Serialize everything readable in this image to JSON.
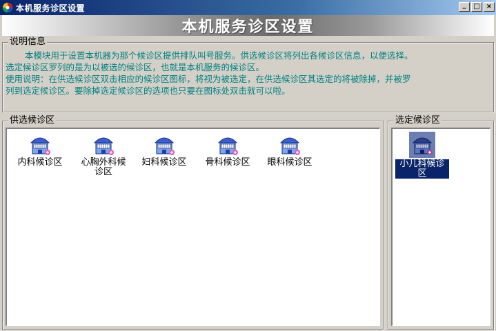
{
  "window": {
    "title": "本机服务诊区设置",
    "buttons": {
      "minimize": "_",
      "maximize": "□",
      "close": "×"
    }
  },
  "banner": {
    "title": "本机服务诊区设置"
  },
  "info": {
    "label": "说明信息",
    "line1": "本模块用于设置本机器为那个候诊区提供排队叫号服务。供选候诊区将列出各候诊区信息，以便选择。",
    "line2": "选定候诊区罗列的是为以被选的候诊区，也就是本机服务的候诊区。",
    "line3": "使用说明：在供选候诊区双击相应的候诊区图标，将视为被选定，在供选候诊区其选定的将被除掉，并被罗",
    "line4": "列到选定候诊区。要除掉选定候诊区的选项也只要在图标处双击就可以啦。"
  },
  "available": {
    "label": "供选候诊区",
    "items": [
      {
        "label": "内科候诊区"
      },
      {
        "label": "心胸外科候诊区"
      },
      {
        "label": "妇科候诊区"
      },
      {
        "label": "骨科候诊区"
      },
      {
        "label": "眼科候诊区"
      }
    ]
  },
  "selected": {
    "label": "选定候诊区",
    "items": [
      {
        "label": "小儿科候诊区"
      }
    ]
  },
  "colors": {
    "info_text": "#008080",
    "selection": "#0a246a",
    "titlebar": "#0a246a"
  },
  "icons": {
    "app": "app-globe-icon",
    "clinic": "clinic-building-icon"
  }
}
